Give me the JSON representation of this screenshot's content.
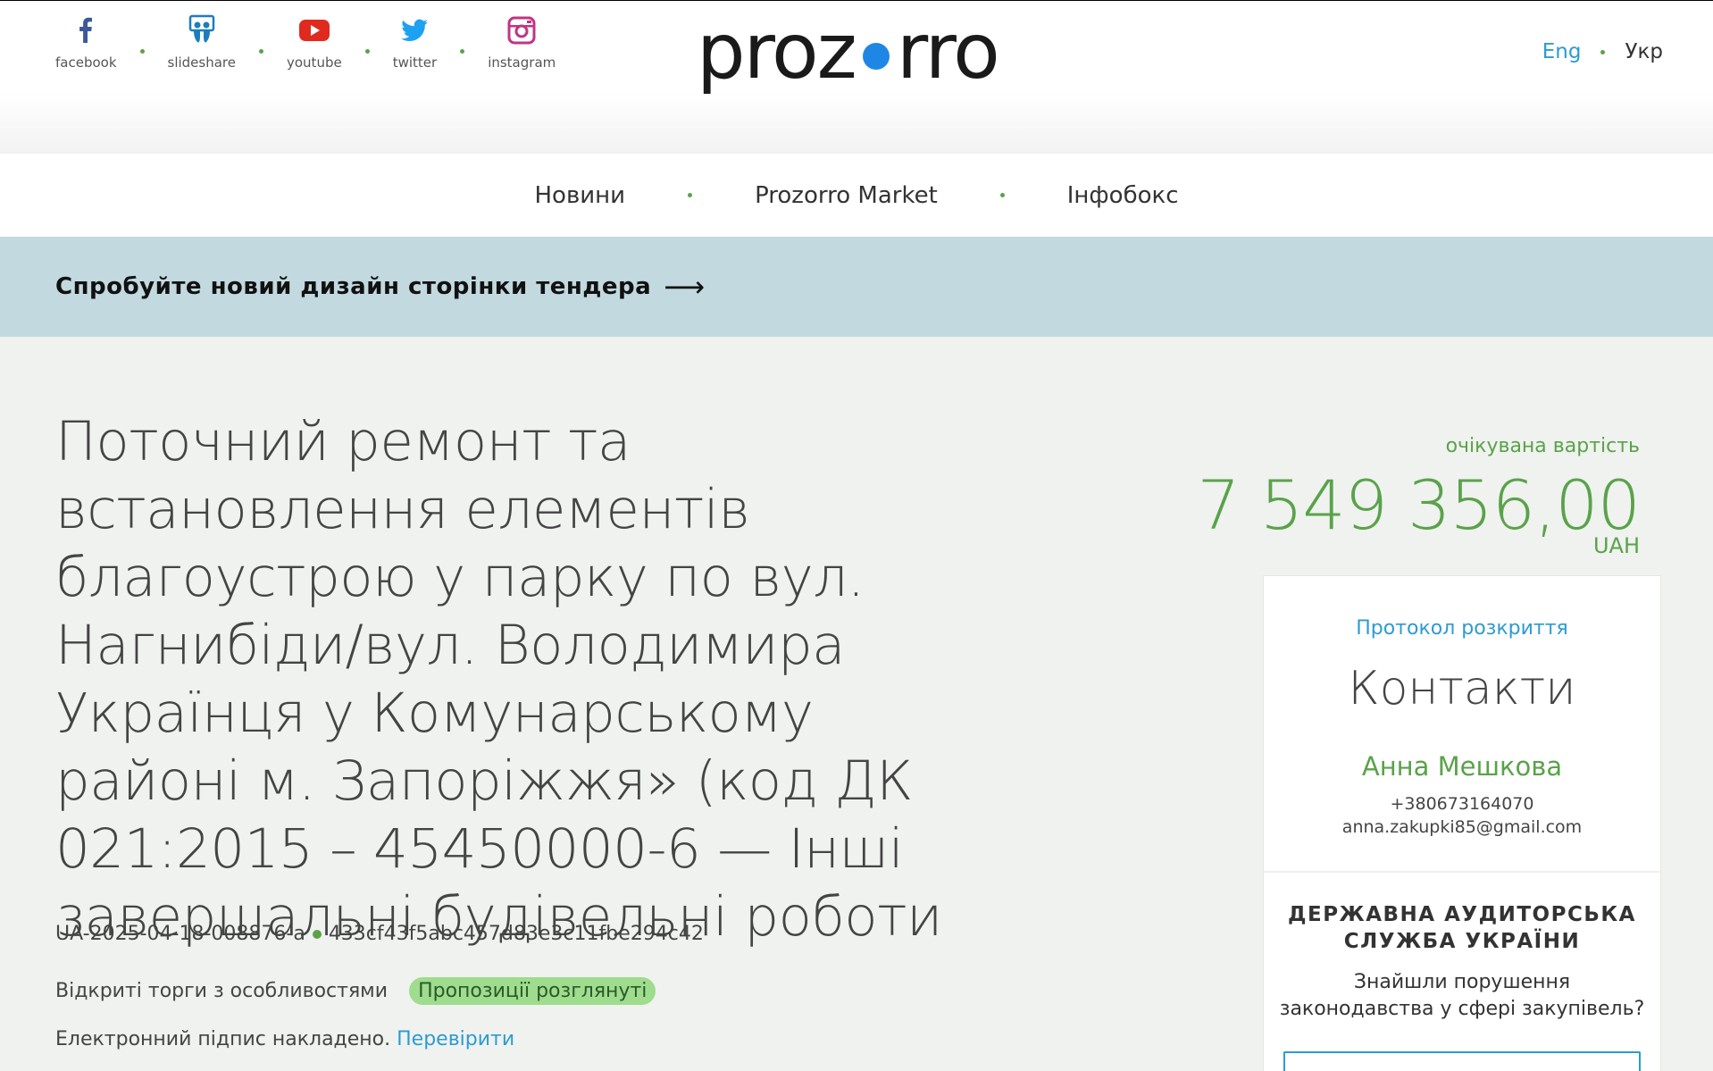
{
  "header": {
    "social": [
      {
        "label": "facebook",
        "icon": "facebook-icon",
        "color": "#3b5998"
      },
      {
        "label": "slideshare",
        "icon": "slideshare-icon",
        "color": "#1d7cbe"
      },
      {
        "label": "youtube",
        "icon": "youtube-icon",
        "color": "#e02a20"
      },
      {
        "label": "twitter",
        "icon": "twitter-icon",
        "color": "#1da1f2"
      },
      {
        "label": "instagram",
        "icon": "instagram-icon",
        "color": "#c13584"
      }
    ],
    "logo_left": "proz",
    "logo_right": "rro",
    "lang_eng": "Eng",
    "lang_ukr": "Укр"
  },
  "nav": {
    "items": [
      "Новини",
      "Prozorro Market",
      "Інфобокс"
    ]
  },
  "banner": {
    "text": "Спробуйте новий дизайн сторінки тендера",
    "arrow": "⟶"
  },
  "tender": {
    "title": "Поточний ремонт та встановлення елементів благоустрою у парку по вул. Нагнибіди/вул. Володимира Українця у Комунарському районі м. Запоріжжя» (код ДК 021:2015 – 45450000-6 — Інші завершальні будівельні роботи",
    "tender_id": "UA-2025-04-18-008876-a",
    "hash": "433cf43f5abc457d83e3c11fbe294c42",
    "procedure": "Відкриті торги з особливостями",
    "status": "Пропозиції розглянуті",
    "signature_text": "Електронний підпис накладено.",
    "signature_link": "Перевірити"
  },
  "value": {
    "label": "очікувана вартість",
    "amount": "7 549 356,00",
    "currency": "UAH"
  },
  "card": {
    "protocol": "Протокол розкриття",
    "contacts_title": "Контакти",
    "contact_name": "Анна Мешкова",
    "phone": "+380673164070",
    "email": "anna.zakupki85@gmail.com",
    "audit_title_line1": "ДЕРЖАВНА АУДИТОРСЬКА",
    "audit_title_line2": "СЛУЖБА УКРАЇНИ",
    "audit_text_line1": "Знайшли порушення",
    "audit_text_line2": "законодавства у сфері закупівель?"
  },
  "colors": {
    "accent_green": "#5aa24a",
    "link_blue": "#2d9bd2",
    "banner_bg": "#c1d9df",
    "logo_dot": "#1e87e6"
  }
}
